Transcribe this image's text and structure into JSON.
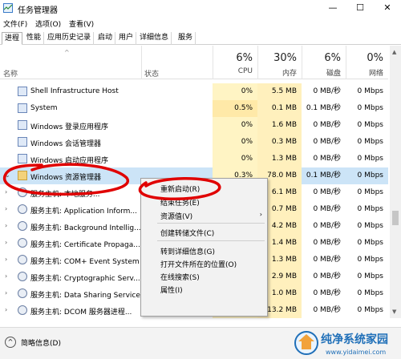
{
  "window": {
    "title": "任务管理器",
    "minimize": "—",
    "maximize": "☐",
    "close": "✕"
  },
  "menu": [
    "文件(F)",
    "选项(O)",
    "查看(V)"
  ],
  "tabs": [
    "进程",
    "性能",
    "应用历史记录",
    "启动",
    "用户",
    "详细信息",
    "服务"
  ],
  "header": {
    "sort_caret": "^",
    "name": "名称",
    "status": "状态",
    "cpu": {
      "pct": "6%",
      "label": "CPU"
    },
    "mem": {
      "pct": "30%",
      "label": "内存"
    },
    "disk": {
      "pct": "6%",
      "label": "磁盘"
    },
    "net": {
      "pct": "0%",
      "label": "网络"
    }
  },
  "rows": [
    {
      "name": "Shell Infrastructure Host",
      "cpu": "0%",
      "mem": "5.5 MB",
      "disk": "0 MB/秒",
      "net": "0 Mbps"
    },
    {
      "name": "System",
      "cpu": "0.5%",
      "mem": "0.1 MB",
      "disk": "0.1 MB/秒",
      "net": "0 Mbps"
    },
    {
      "name": "Windows 登录应用程序",
      "cpu": "0%",
      "mem": "1.6 MB",
      "disk": "0 MB/秒",
      "net": "0 Mbps"
    },
    {
      "name": "Windows 会话管理器",
      "cpu": "0%",
      "mem": "0.3 MB",
      "disk": "0 MB/秒",
      "net": "0 Mbps"
    },
    {
      "name": "Windows 启动应用程序",
      "cpu": "0%",
      "mem": "1.3 MB",
      "disk": "0 MB/秒",
      "net": "0 Mbps"
    },
    {
      "name": "Windows 资源管理器",
      "cpu": "0.3%",
      "mem": "78.0 MB",
      "disk": "0.1 MB/秒",
      "net": "0 Mbps"
    },
    {
      "name": "服务主机: 本地服务...",
      "cpu": "",
      "mem": "6.1 MB",
      "disk": "0 MB/秒",
      "net": "0 Mbps"
    },
    {
      "name": "服务主机: Application Inform...",
      "cpu": "",
      "mem": "0.7 MB",
      "disk": "0 MB/秒",
      "net": "0 Mbps"
    },
    {
      "name": "服务主机: Background Intellig...",
      "cpu": "",
      "mem": "4.2 MB",
      "disk": "0 MB/秒",
      "net": "0 Mbps"
    },
    {
      "name": "服务主机: Certificate Propaga...",
      "cpu": "",
      "mem": "1.4 MB",
      "disk": "0 MB/秒",
      "net": "0 Mbps"
    },
    {
      "name": "服务主机: COM+ Event System",
      "cpu": "",
      "mem": "1.3 MB",
      "disk": "0 MB/秒",
      "net": "0 Mbps"
    },
    {
      "name": "服务主机: Cryptographic Serv...",
      "cpu": "",
      "mem": "2.9 MB",
      "disk": "0 MB/秒",
      "net": "0 Mbps"
    },
    {
      "name": "服务主机: Data Sharing Service",
      "cpu": "",
      "mem": "1.0 MB",
      "disk": "0 MB/秒",
      "net": "0 Mbps"
    },
    {
      "name": "服务主机: DCOM 服务器进程...",
      "cpu": "0%",
      "mem": "13.2 MB",
      "disk": "0 MB/秒",
      "net": "0 Mbps"
    }
  ],
  "context_menu": {
    "restart": "重新启动(R)",
    "end_task": "结束任务(E)",
    "resource_values": "资源值(V)",
    "create_dump": "创建转储文件(C)",
    "goto_details": "转到详细信息(G)",
    "open_location": "打开文件所在的位置(O)",
    "search_online": "在线搜索(S)",
    "properties": "属性(I)",
    "submenu_arrow": "›"
  },
  "footer": {
    "label": "简略信息(D)",
    "icon": "^"
  },
  "watermark": {
    "name": "纯净系统家园",
    "url": "www.yidaimei.com"
  },
  "colors": {
    "cpu_highlight": "#fff4c4",
    "mem_highlight": "#fff0bd",
    "annotation_red": "#e00000",
    "watermark_blue": "#1f6fb8"
  }
}
